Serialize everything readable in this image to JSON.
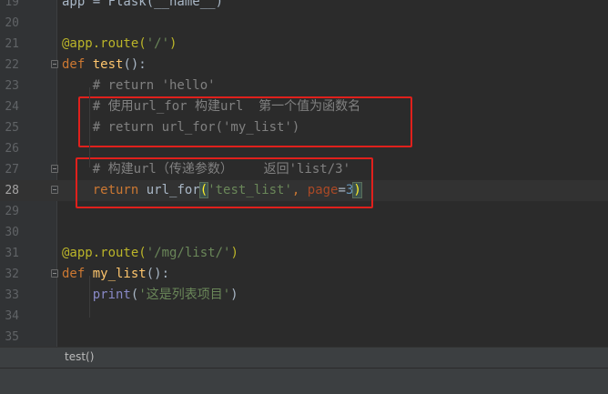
{
  "editor": {
    "lines": [
      {
        "n": "19",
        "tokens": [
          {
            "t": "app = Flask(__name__)",
            "c": ""
          }
        ]
      },
      {
        "n": "20",
        "tokens": []
      },
      {
        "n": "21",
        "tokens": [
          {
            "t": "@app.route(",
            "c": "deco"
          },
          {
            "t": "'/'",
            "c": "str"
          },
          {
            "t": ")",
            "c": "deco"
          }
        ]
      },
      {
        "n": "22",
        "fold": true,
        "tokens": [
          {
            "t": "def ",
            "c": "kw"
          },
          {
            "t": "test",
            "c": "fn"
          },
          {
            "t": "():",
            "c": ""
          }
        ]
      },
      {
        "n": "23",
        "indent": true,
        "tokens": [
          {
            "t": "    # return 'hello'",
            "c": "cmt"
          }
        ]
      },
      {
        "n": "24",
        "indent": true,
        "tokens": [
          {
            "t": "    # 使用url_for 构建url  第一个值为函数名",
            "c": "cmt"
          }
        ]
      },
      {
        "n": "25",
        "indent": true,
        "tokens": [
          {
            "t": "    # return url_for('my_list')",
            "c": "cmt"
          }
        ]
      },
      {
        "n": "26",
        "tokens": []
      },
      {
        "n": "27",
        "fold": true,
        "indent": true,
        "tokens": [
          {
            "t": "    # 构建url（传递参数）    返回'list/3'",
            "c": "cmt"
          }
        ]
      },
      {
        "n": "28",
        "current": true,
        "fold": true,
        "tokens": [
          {
            "t": "    ",
            "c": ""
          },
          {
            "t": "return ",
            "c": "kw"
          },
          {
            "t": "url_for",
            "c": ""
          },
          {
            "t": "(",
            "c": "brace-match"
          },
          {
            "t": "'test_list'",
            "c": "str"
          },
          {
            "t": ", ",
            "c": "kw"
          },
          {
            "t": "page",
            "c": "param"
          },
          {
            "t": "=",
            "c": ""
          },
          {
            "t": "3",
            "c": "num"
          },
          {
            "t": ")",
            "c": "brace-match"
          }
        ]
      },
      {
        "n": "29",
        "tokens": []
      },
      {
        "n": "30",
        "tokens": []
      },
      {
        "n": "31",
        "tokens": [
          {
            "t": "@app.route(",
            "c": "deco"
          },
          {
            "t": "'/mg/list/'",
            "c": "str"
          },
          {
            "t": ")",
            "c": "deco"
          }
        ]
      },
      {
        "n": "32",
        "fold": true,
        "tokens": [
          {
            "t": "def ",
            "c": "kw"
          },
          {
            "t": "my_list",
            "c": "fn"
          },
          {
            "t": "():",
            "c": ""
          }
        ]
      },
      {
        "n": "33",
        "indent": true,
        "tokens": [
          {
            "t": "    ",
            "c": ""
          },
          {
            "t": "print",
            "c": "builtin"
          },
          {
            "t": "(",
            "c": ""
          },
          {
            "t": "'这是列表项目'",
            "c": "str"
          },
          {
            "t": ")",
            "c": ""
          }
        ]
      },
      {
        "n": "34",
        "tokens": []
      },
      {
        "n": "35",
        "tokens": []
      }
    ]
  },
  "breadcrumb": {
    "label": "test()"
  },
  "colors": {
    "background": "#2b2b2b",
    "highlight_box": "#e0201c",
    "keyword": "#cc7832",
    "string": "#6a8759",
    "comment": "#808080"
  }
}
